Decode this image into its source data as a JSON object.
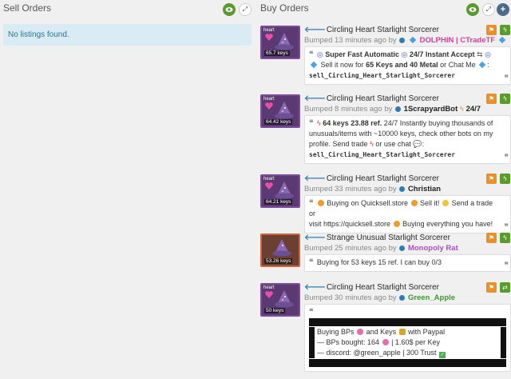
{
  "sell": {
    "title": "Sell Orders",
    "empty_text": "No listings found."
  },
  "buy": {
    "title": "Buy Orders"
  },
  "icons": {
    "eye": "eye-icon",
    "expand": "expand-icon",
    "add": "plus-icon",
    "flag": "flag-icon",
    "bolt": "lightning-icon",
    "swap": "swap-icon",
    "quote": "quote-icon"
  },
  "colors": {
    "accent_green": "#5b9a2f",
    "accent_orange": "#e8902a",
    "link_blue": "#2e7db5",
    "dolphin_pink": "#d23ca0",
    "monopoly_purple": "#b04bc8",
    "green_apple": "#3a9a2a"
  },
  "listings": [
    {
      "thumb_label": "heart",
      "price": "65.7 keys",
      "title": "Circling Heart Starlight Sorcerer",
      "bumped": "Bumped 13 minutes ago by",
      "user": "DOLPHIN | CTradeTF",
      "message": {
        "line1": "Super Fast Automatic",
        "line1b": "24/7 Instant Accept",
        "line2": "Sell it now for",
        "line2b": "65 Keys and 40 Metal",
        "line2c": "or Chat Me",
        "line3": "sell_Circling_Heart_Starlight_Sorcerer"
      }
    },
    {
      "thumb_label": "heart",
      "price": "64.42 keys",
      "title": "Circling Heart Starlight Sorcerer",
      "bumped": "Bumped 8 minutes ago by",
      "user": "1ScrapyardBot",
      "user_suffix": "24/7",
      "message": {
        "line1a": "64 keys 23.88 ref.",
        "line1b": "24/7 Instantly buying thousands of",
        "line2": "unusuals/items with ~10000 keys, check other bots on my",
        "line3a": "profile. Send  trade",
        "line3b": "or  use  chat",
        "line4": "sell_Circling_Heart_Starlight_Sorcerer"
      }
    },
    {
      "thumb_label": "heart",
      "price": "64.21 keys",
      "title": "Circling Heart Starlight Sorcerer",
      "bumped": "Bumped 33 minutes ago by",
      "user": "Christian",
      "message": {
        "line1a": "Buying on Quicksell.store",
        "line1b": "Sell it!",
        "line1c": "Send a trade or",
        "line2a": "visit https://quicksell.store",
        "line2b": "Buying everything you have!"
      }
    },
    {
      "thumb_label": "",
      "price": "53.26 keys",
      "title": "Strange Unusual Starlight Sorcerer",
      "bumped": "Bumped 25 minutes ago by",
      "user": "Monopoly Rat",
      "message": {
        "line1": "Buying for 53 keys 15 ref. I can buy 0/3"
      }
    },
    {
      "thumb_label": "heart",
      "price": "50 keys",
      "title": "Circling Heart Starlight Sorcerer",
      "bumped": "Bumped 30 minutes ago by",
      "user": "Green_Apple",
      "message": {
        "line1a": "Buying BPs",
        "line1b": "and Keys",
        "line1c": "with Paypal",
        "line2a": "— BPs bought: 164",
        "line2b": "| 1.60$ per Key",
        "line3a": "— discord: @green_apple | 300 Trust"
      }
    }
  ]
}
